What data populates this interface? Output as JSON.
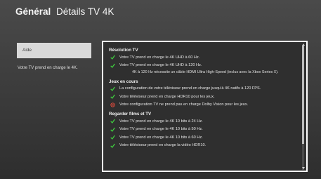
{
  "header": {
    "category": "Général",
    "title": "Détails TV 4K"
  },
  "sidebar": {
    "help_label": "Aide",
    "summary": "Votre TV prend en charge le 4K."
  },
  "colors": {
    "ok": "#3fd13f",
    "error": "#e84d3d",
    "focus": "#ffffff"
  },
  "sections": {
    "resolution": {
      "title": "Résolution TV",
      "items": [
        {
          "status": "ok",
          "text": "Votre TV prend en charge le 4K UHD à 60 Hz."
        },
        {
          "status": "ok",
          "text": "Votre TV prend en charge le 4K UHD à 120 Hz."
        }
      ],
      "note": "4K à 120 Hz nécessite un câble HDMI Ultra High-Speed (inclus avec la Xbox Series X)."
    },
    "games": {
      "title": "Jeux en cours",
      "items": [
        {
          "status": "ok",
          "text": "La configuration de votre téléviseur prend en charge jusqu'à 4K natifs à 120 FPS."
        },
        {
          "status": "ok",
          "text": "Votre téléviseur prend en charge HDR10 pour les jeux."
        },
        {
          "status": "error",
          "text": "Votre configuration TV ne prend pas en charge Dolby Vision pour les jeux."
        }
      ]
    },
    "movies": {
      "title": "Regarder films et TV",
      "items": [
        {
          "status": "ok",
          "text": "Votre TV prend en charge le 4K 10 bits à 24 Hz."
        },
        {
          "status": "ok",
          "text": "Votre TV prend en charge le 4K 10 bits à 50 Hz."
        },
        {
          "status": "ok",
          "text": "Votre TV prend en charge le 4K 10 bits à 60 Hz."
        },
        {
          "status": "ok",
          "text": "Votre téléviseur prend en charge la vidéo HDR10."
        }
      ]
    }
  },
  "icons": {
    "ok": "checkmark-icon",
    "error": "error-circle-icon"
  }
}
